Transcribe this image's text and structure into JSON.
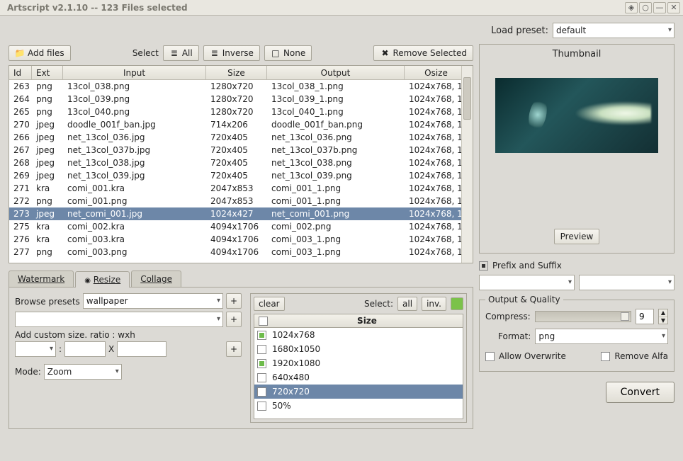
{
  "title": "Artscript v2.1.10 -- 123 Files selected",
  "preset": {
    "label": "Load preset:",
    "value": "default"
  },
  "toolbar": {
    "add_files": "Add files",
    "select_label": "Select",
    "all": "All",
    "inverse": "Inverse",
    "none": "None",
    "remove": "Remove Selected"
  },
  "columns": {
    "id": "Id",
    "ext": "Ext",
    "input": "Input",
    "size": "Size",
    "output": "Output",
    "osize": "Osize"
  },
  "files": [
    {
      "id": "263",
      "ext": "png",
      "input": "13col_038.png",
      "size": "1280x720",
      "output": "13col_038_1.png",
      "osize": "1024x768, 1",
      "sel": false
    },
    {
      "id": "264",
      "ext": "png",
      "input": "13col_039.png",
      "size": "1280x720",
      "output": "13col_039_1.png",
      "osize": "1024x768, 1",
      "sel": false
    },
    {
      "id": "265",
      "ext": "png",
      "input": "13col_040.png",
      "size": "1280x720",
      "output": "13col_040_1.png",
      "osize": "1024x768, 1",
      "sel": false
    },
    {
      "id": "270",
      "ext": "jpeg",
      "input": "doodle_001f_ban.jpg",
      "size": "714x206",
      "output": "doodle_001f_ban.png",
      "osize": "1024x768, 1",
      "sel": false
    },
    {
      "id": "266",
      "ext": "jpeg",
      "input": "net_13col_036.jpg",
      "size": "720x405",
      "output": "net_13col_036.png",
      "osize": "1024x768, 1",
      "sel": false
    },
    {
      "id": "267",
      "ext": "jpeg",
      "input": "net_13col_037b.jpg",
      "size": "720x405",
      "output": "net_13col_037b.png",
      "osize": "1024x768, 1",
      "sel": false
    },
    {
      "id": "268",
      "ext": "jpeg",
      "input": "net_13col_038.jpg",
      "size": "720x405",
      "output": "net_13col_038.png",
      "osize": "1024x768, 1",
      "sel": false
    },
    {
      "id": "269",
      "ext": "jpeg",
      "input": "net_13col_039.jpg",
      "size": "720x405",
      "output": "net_13col_039.png",
      "osize": "1024x768, 1",
      "sel": false
    },
    {
      "id": "271",
      "ext": "kra",
      "input": "comi_001.kra",
      "size": "2047x853",
      "output": "comi_001_1.png",
      "osize": "1024x768, 1",
      "sel": false
    },
    {
      "id": "272",
      "ext": "png",
      "input": "comi_001.png",
      "size": "2047x853",
      "output": "comi_001_1.png",
      "osize": "1024x768, 1",
      "sel": false
    },
    {
      "id": "273",
      "ext": "jpeg",
      "input": "net_comi_001.jpg",
      "size": "1024x427",
      "output": "net_comi_001.png",
      "osize": "1024x768, 1",
      "sel": true
    },
    {
      "id": "275",
      "ext": "kra",
      "input": "comi_002.kra",
      "size": "4094x1706",
      "output": "comi_002.png",
      "osize": "1024x768, 1",
      "sel": false
    },
    {
      "id": "276",
      "ext": "kra",
      "input": "comi_003.kra",
      "size": "4094x1706",
      "output": "comi_003_1.png",
      "osize": "1024x768, 1",
      "sel": false
    },
    {
      "id": "277",
      "ext": "png",
      "input": "comi_003.png",
      "size": "4094x1706",
      "output": "comi_003_1.png",
      "osize": "1024x768, 1",
      "sel": false
    }
  ],
  "thumbnail": {
    "title": "Thumbnail",
    "preview": "Preview"
  },
  "tabs": {
    "watermark": "Watermark",
    "resize": "Resize",
    "collage": "Collage",
    "resize_marker": "◉"
  },
  "resize": {
    "browse_label": "Browse presets",
    "preset_value": "wallpaper",
    "custom_label": "Add custom size. ratio : wxh",
    "x": "X",
    "colon": ":",
    "mode_label": "Mode:",
    "mode_value": "Zoom",
    "clear": "clear",
    "select_label": "Select:",
    "all": "all",
    "inv": "inv.",
    "size_header": "Size",
    "sizes": [
      {
        "label": "1024x768",
        "on": true,
        "sel": false
      },
      {
        "label": "1680x1050",
        "on": false,
        "sel": false
      },
      {
        "label": "1920x1080",
        "on": true,
        "sel": false
      },
      {
        "label": "640x480",
        "on": false,
        "sel": false
      },
      {
        "label": "720x720",
        "on": false,
        "sel": true
      },
      {
        "label": "50%",
        "on": false,
        "sel": false
      }
    ]
  },
  "right": {
    "prefix_suffix": "Prefix and Suffix",
    "output_quality": "Output & Quality",
    "compress": "Compress:",
    "compress_value": "9",
    "format_label": "Format:",
    "format_value": "png",
    "allow_overwrite": "Allow Overwrite",
    "remove_alfa": "Remove Alfa",
    "convert": "Convert"
  },
  "glyphs": {
    "plus": "+",
    "caret": "▾",
    "check": "✕",
    "circle_min": "⊖",
    "square": "□",
    "maximize": "□",
    "close": "✕",
    "list": "≣"
  }
}
